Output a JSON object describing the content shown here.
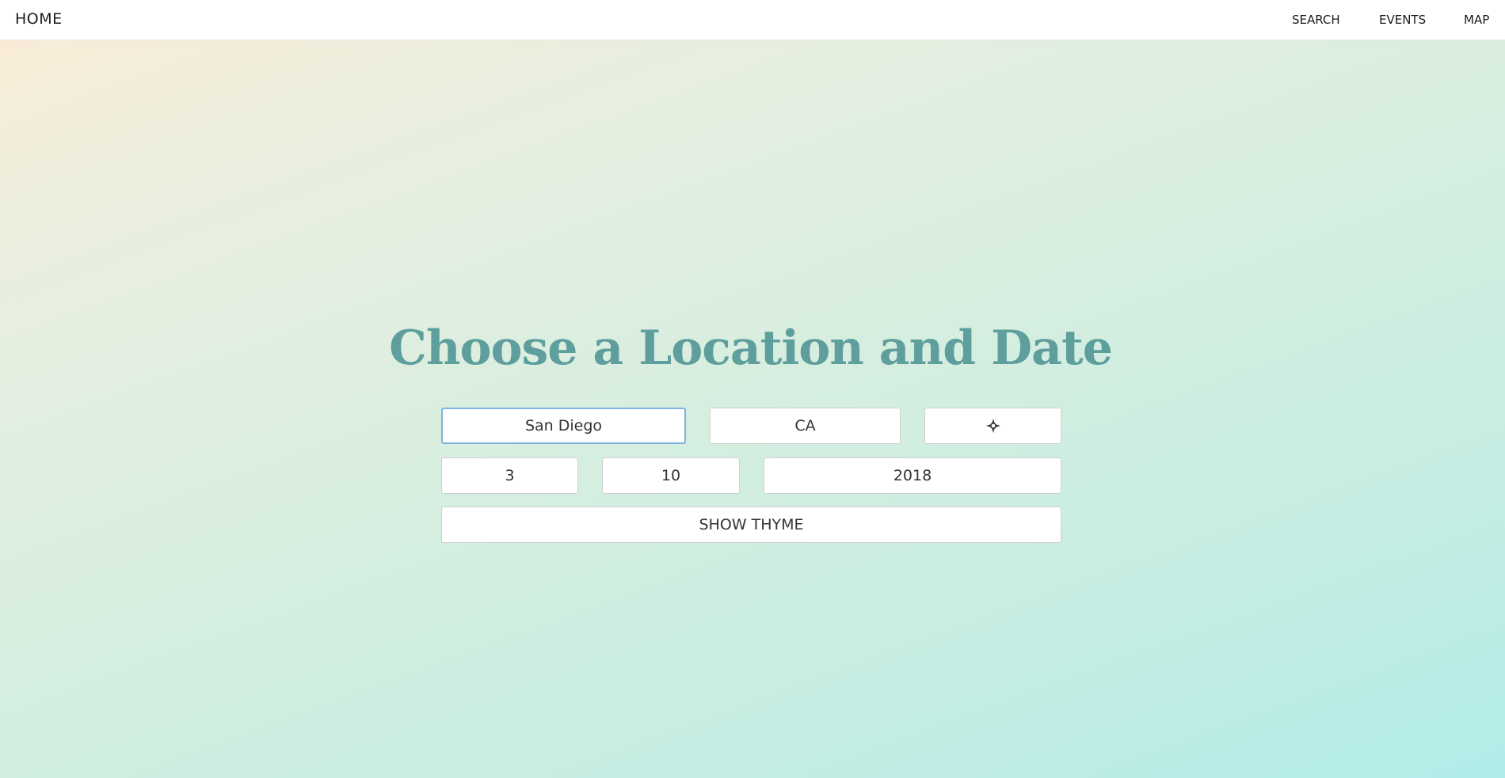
{
  "nav": {
    "home": "HOME",
    "links": [
      "SEARCH",
      "EVENTS",
      "MAP"
    ]
  },
  "main": {
    "title": "Choose a Location and Date",
    "city": "San Diego",
    "state": "CA",
    "locate_icon": "crosshair-locate-icon",
    "month": "3",
    "day": "10",
    "year": "2018",
    "submit_label": "SHOW THYME"
  },
  "colors": {
    "title": "#5e9e9c",
    "focus_border": "#7fb2e0",
    "gradient_start": "#fbecd6",
    "gradient_end": "#b1ece9"
  }
}
